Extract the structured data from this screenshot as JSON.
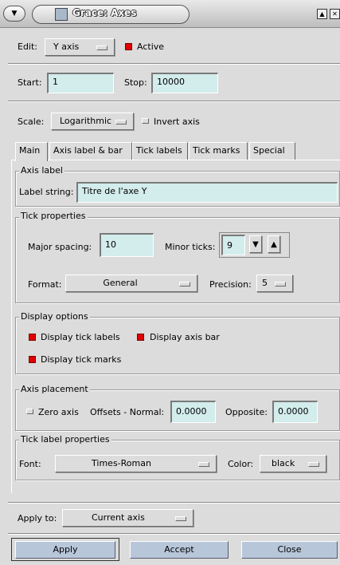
{
  "window": {
    "title": "Grace: Axes",
    "menu_icon": "chevron-down-icon",
    "icon": "window-app-icon",
    "buttons": [
      "maximize-icon",
      "close-icon"
    ]
  },
  "top": {
    "edit_label": "Edit:",
    "edit_value": "Y axis",
    "active_label": "Active",
    "start_label": "Start:",
    "start_value": "1",
    "stop_label": "Stop:",
    "stop_value": "10000",
    "scale_label": "Scale:",
    "scale_value": "Logarithmic",
    "invert_label": "Invert axis"
  },
  "tabs": [
    "Main",
    "Axis label & bar",
    "Tick labels",
    "Tick marks",
    "Special"
  ],
  "axis_label": {
    "title": "Axis label",
    "string_label": "Label string:",
    "string_value": "Titre de l'axe Y"
  },
  "tick_properties": {
    "title": "Tick properties",
    "major_label": "Major spacing:",
    "major_value": "10",
    "minor_label": "Minor ticks:",
    "minor_value": "9",
    "format_label": "Format:",
    "format_value": "General",
    "precision_label": "Precision:",
    "precision_value": "5"
  },
  "display_options": {
    "title": "Display options",
    "tick_labels": "Display tick labels",
    "axis_bar": "Display axis bar",
    "tick_marks": "Display tick marks"
  },
  "axis_placement": {
    "title": "Axis placement",
    "zero_axis": "Zero axis",
    "offsets_normal_label": "Offsets - Normal:",
    "normal_value": "0.0000",
    "opposite_label": "Opposite:",
    "opposite_value": "0.0000"
  },
  "tick_label_properties": {
    "title": "Tick label properties",
    "font_label": "Font:",
    "font_value": "Times-Roman",
    "color_label": "Color:",
    "color_value": "black"
  },
  "apply_to": {
    "label": "Apply to:",
    "value": "Current axis"
  },
  "actions": {
    "apply": "Apply",
    "accept": "Accept",
    "close": "Close"
  },
  "colors": {
    "field_bg": "#d3ecec",
    "toggle_on": "#e00000",
    "action_button": "#b8c6da",
    "window_bg": "#dcdcdc"
  }
}
